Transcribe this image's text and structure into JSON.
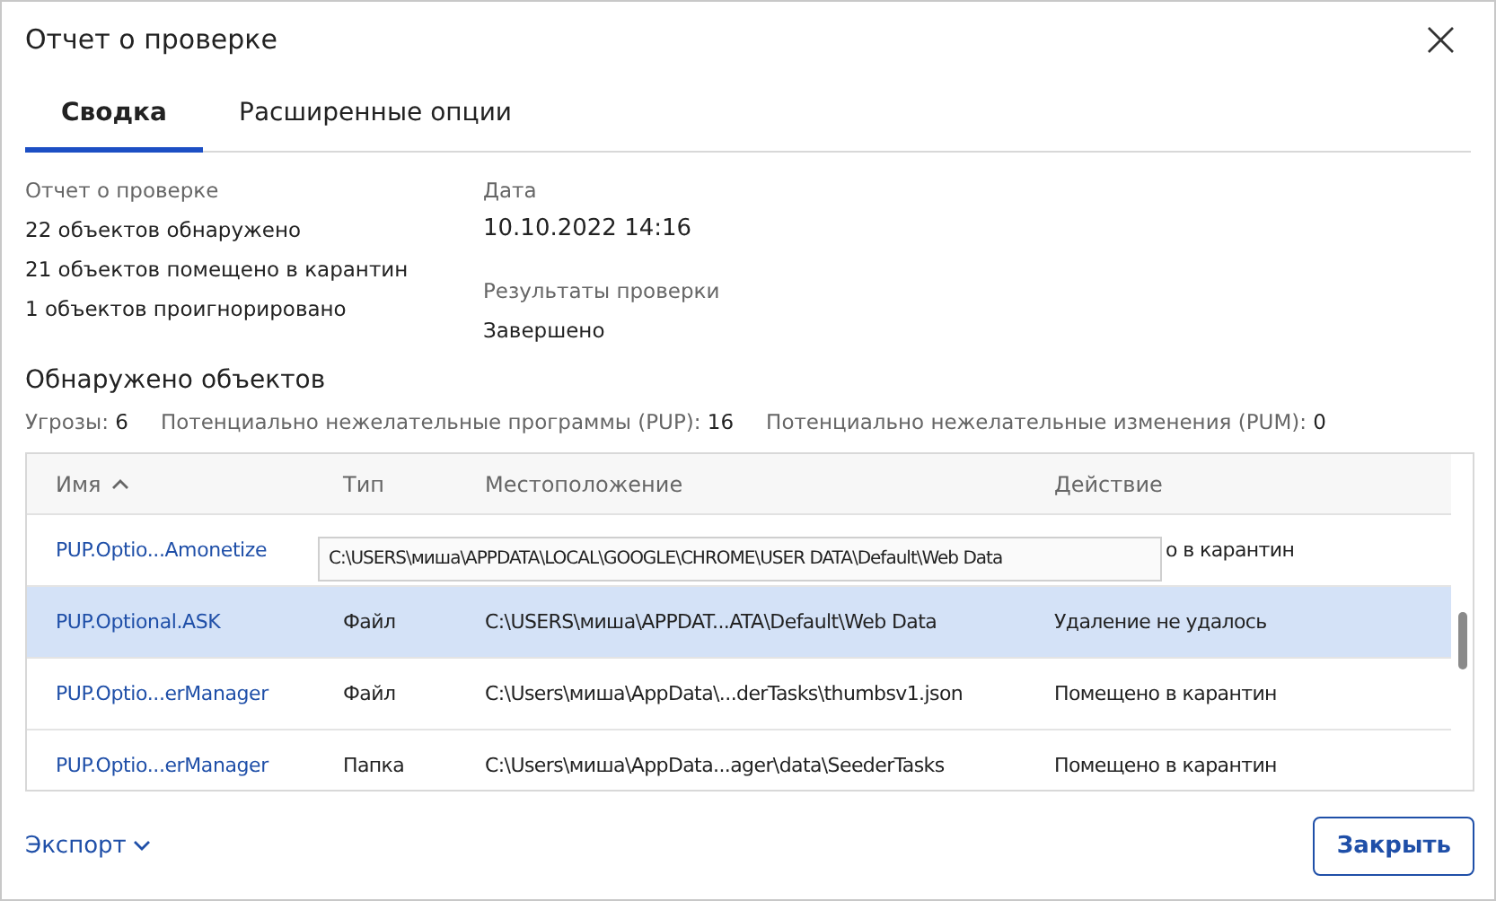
{
  "window": {
    "title": "Отчет о проверке",
    "close": "×"
  },
  "tabs": [
    {
      "label": "Сводка",
      "selected": true
    },
    {
      "label": "Расширенные опции",
      "selected": false
    }
  ],
  "summary": {
    "heading": "Отчет о проверке",
    "lines": [
      "22 объектов обнаружено",
      "21 объектов помещено в карантин",
      "1 объектов проигнорировано"
    ],
    "date_label": "Дата",
    "date": "10.10.2022 14:16",
    "result_label": "Результаты проверки",
    "result": "Завершено"
  },
  "detected": {
    "title": "Обнаружено объектов",
    "counts": [
      {
        "label": "Угрозы:",
        "value": "6"
      },
      {
        "label": "Потенциально нежелательные программы (PUP):",
        "value": "16"
      },
      {
        "label": "Потенциально нежелательные изменения (PUM):",
        "value": "0"
      }
    ]
  },
  "table": {
    "columns": [
      {
        "label": "Имя",
        "sorted": true
      },
      {
        "label": "Тип",
        "sorted": false
      },
      {
        "label": "Местоположение",
        "sorted": false
      },
      {
        "label": "Действие",
        "sorted": false
      }
    ],
    "rows": [
      {
        "name": "PUP.Optio...Amonetize",
        "type": "",
        "location": "",
        "action": "о в карантин",
        "selected": false
      },
      {
        "name": "PUP.Optional.ASK",
        "type": "Файл",
        "location": "C:\\USERS\\миша\\APPDAT...ATA\\Default\\Web Data",
        "action": "Удаление не удалось",
        "selected": true
      },
      {
        "name": "PUP.Optio...erManager",
        "type": "Файл",
        "location": "C:\\Users\\миша\\AppData\\...derTasks\\thumbsv1.json",
        "action": "Помещено в карантин",
        "selected": false
      },
      {
        "name": "PUP.Optio...erManager",
        "type": "Папка",
        "location": "C:\\Users\\миша\\AppData...ager\\data\\SeederTasks",
        "action": "Помещено в карантин",
        "selected": false
      }
    ],
    "tooltip": "C:\\USERS\\миша\\APPDATA\\LOCAL\\GOOGLE\\CHROME\\USER DATA\\Default\\Web Data"
  },
  "footer": {
    "export": "Экспорт",
    "close_button": "Закрыть"
  }
}
